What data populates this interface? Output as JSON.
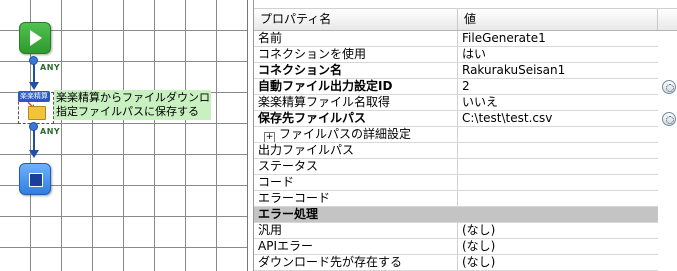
{
  "flow": {
    "any_label_top": "ANY",
    "any_label_bottom": "ANY",
    "action_badge": "楽楽精算",
    "action_caption_line1": "楽楽精算からファイルダウンロード",
    "action_caption_line2": "指定ファイルパスに保存する"
  },
  "properties": {
    "header_name": "プロパティ名",
    "header_value": "値",
    "rows": [
      {
        "name": "名前",
        "value": "FileGenerate1"
      },
      {
        "name": "コネクションを使用",
        "value": "はい"
      },
      {
        "name": "コネクション名",
        "value": "RakurakuSeisan1"
      },
      {
        "name": "自動ファイル出力設定ID",
        "value": "2"
      },
      {
        "name": "楽楽精算ファイル名取得",
        "value": "いいえ"
      },
      {
        "name": "保存先ファイルパス",
        "value": "C:\\test\\test.csv"
      },
      {
        "name": "ファイルパスの詳細設定",
        "value": ""
      },
      {
        "name": "出力ファイルパス",
        "value": ""
      },
      {
        "name": "ステータス",
        "value": ""
      },
      {
        "name": "コード",
        "value": ""
      },
      {
        "name": "エラーコード",
        "value": ""
      },
      {
        "name": "エラー処理",
        "value": ""
      },
      {
        "name": "汎用",
        "value": "(なし)"
      },
      {
        "name": "APIエラー",
        "value": "(なし)"
      },
      {
        "name": "ダウンロード先が存在する",
        "value": "(なし)"
      }
    ],
    "expander_symbol": "+"
  }
}
